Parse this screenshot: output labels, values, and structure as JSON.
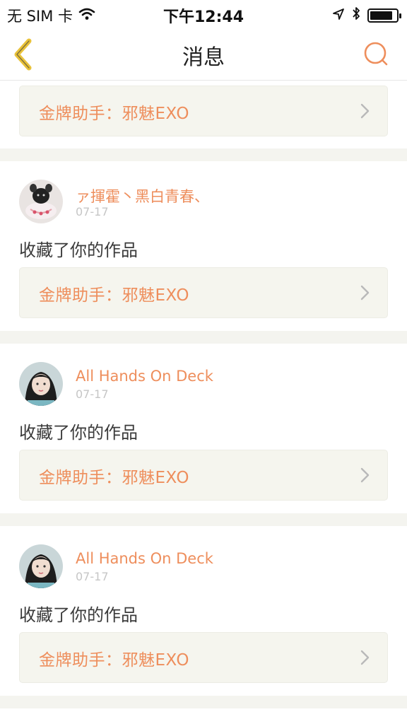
{
  "status_bar": {
    "carrier": "无 SIM 卡",
    "time": "下午12:44",
    "icons": [
      "wifi-icon",
      "location-arrow-icon",
      "bluetooth-icon",
      "battery-icon"
    ]
  },
  "nav": {
    "title": "消息",
    "back_icon": "chevron-left-icon",
    "search_icon": "search-icon"
  },
  "colors": {
    "accent": "#ee8e5c",
    "back": "#e9c23a",
    "card_bg": "#f5f5ee",
    "separator": "#f4f4ef"
  },
  "top_partial_card": {
    "label": "金牌助手：邪魅EXO"
  },
  "messages": [
    {
      "username": "ァ揮霍丶黑白青春、",
      "date": "07-17",
      "action": "收藏了你的作品",
      "ref_label": "金牌助手：邪魅EXO"
    },
    {
      "username": "All Hands On Deck",
      "date": "07-17",
      "action": "收藏了你的作品",
      "ref_label": "金牌助手：邪魅EXO"
    },
    {
      "username": "All Hands On Deck",
      "date": "07-17",
      "action": "收藏了你的作品",
      "ref_label": "金牌助手：邪魅EXO"
    }
  ]
}
